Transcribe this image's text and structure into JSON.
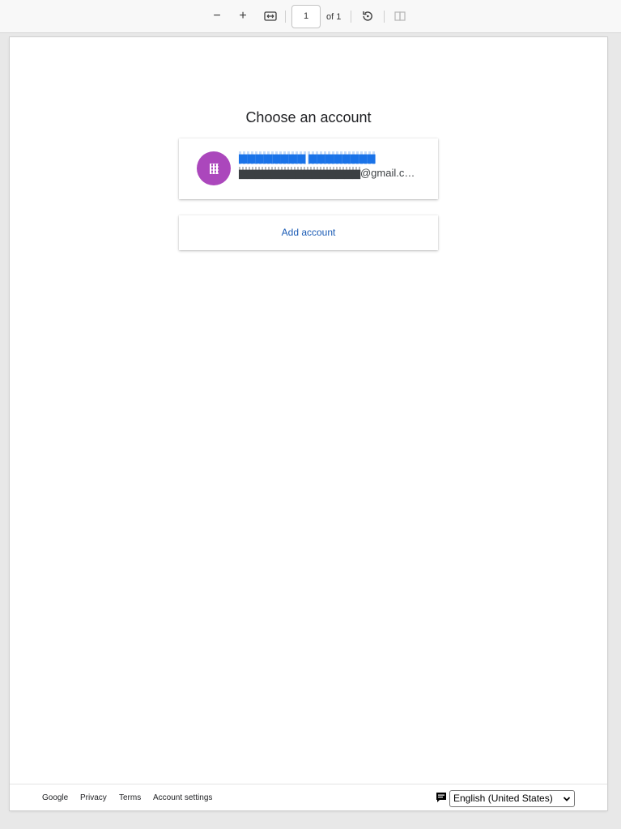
{
  "toolbar": {
    "zoom_out": "−",
    "zoom_in": "+",
    "page_number": "1",
    "page_of": "of 1"
  },
  "page": {
    "title": "Choose an account",
    "account": {
      "name": "▆▆▆▆▆▆▆▆ ▆▆▆▆▆▆▆▆",
      "email_masked": "▆▆▆▆▆▆▆▆▆▆▆▆▆▆▆",
      "email_suffix": "@gmail.c…",
      "avatar_color": "#ab47bc"
    },
    "add_account": "Add account",
    "footer": {
      "links": [
        "Google",
        "Privacy",
        "Terms",
        "Account settings"
      ],
      "language": "English (United States)"
    }
  }
}
